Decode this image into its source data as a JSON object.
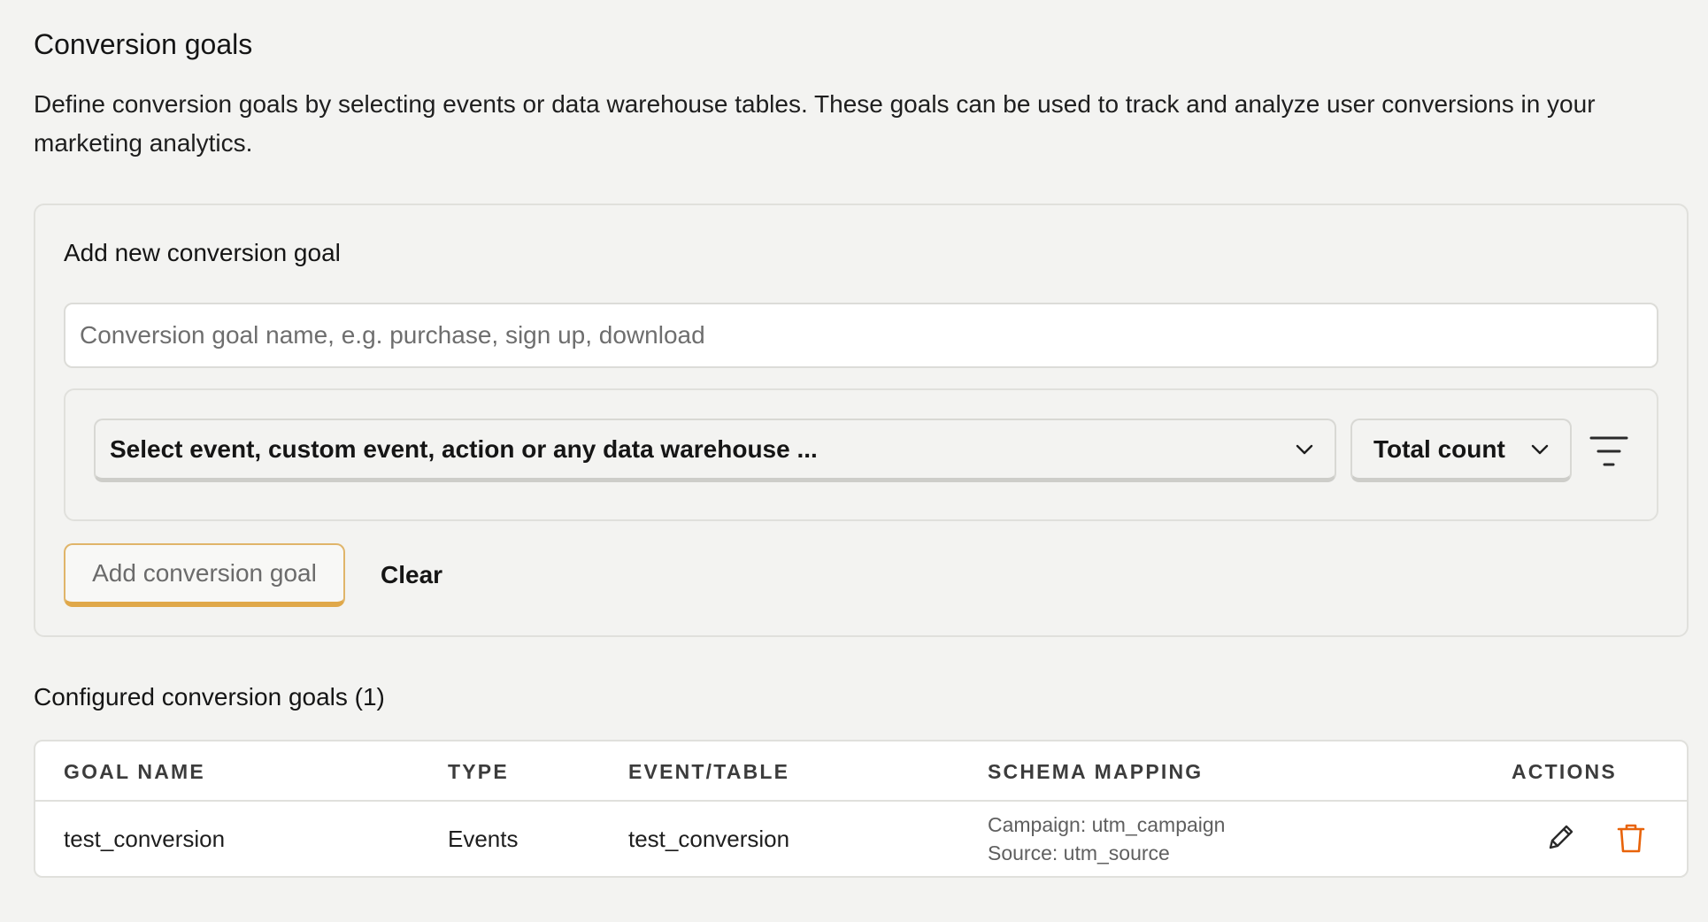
{
  "header": {
    "title": "Conversion goals",
    "description": "Define conversion goals by selecting events or data warehouse tables. These goals can be used to track and analyze user conversions in your marketing analytics."
  },
  "new_goal": {
    "title": "Add new conversion goal",
    "name_input": {
      "value": "",
      "placeholder": "Conversion goal name, e.g. purchase, sign up, download"
    },
    "event_select": {
      "label": "Select event, custom event, action or any data warehouse ..."
    },
    "math_select": {
      "label": "Total count"
    },
    "add_button": "Add conversion goal",
    "clear_button": "Clear"
  },
  "configured": {
    "title": "Configured conversion goals (1)",
    "columns": [
      "GOAL NAME",
      "TYPE",
      "EVENT/TABLE",
      "SCHEMA MAPPING",
      "ACTIONS"
    ],
    "rows": [
      {
        "goal_name": "test_conversion",
        "type": "Events",
        "event_table": "test_conversion",
        "schema_campaign": "Campaign: utm_campaign",
        "schema_source": "Source: utm_source"
      }
    ]
  },
  "colors": {
    "background": "#f3f3f1",
    "primary_accent": "#e0a84a",
    "danger": "#e8630a"
  },
  "icons": [
    "chevron-down-icon",
    "filter-icon",
    "pencil-icon",
    "trash-icon"
  ]
}
